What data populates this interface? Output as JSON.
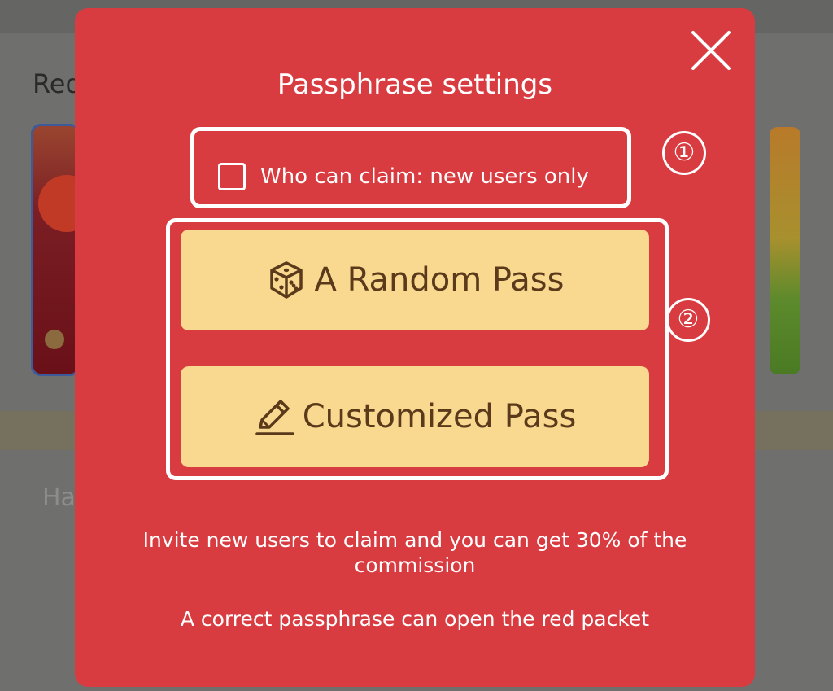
{
  "background": {
    "heading": "Red",
    "hint": "Ha"
  },
  "modal": {
    "title": "Passphrase settings",
    "close_icon": "close-icon",
    "claim_option": {
      "label": "Who can claim: new users only",
      "checked": false
    },
    "annotation_markers": [
      "①",
      "②"
    ],
    "buttons": [
      {
        "label": "A Random Pass",
        "icon": "dice-icon"
      },
      {
        "label": "Customized Pass",
        "icon": "pencil-icon"
      }
    ],
    "info_commission": "Invite new users to claim and you can get 30% of the commission",
    "info_passphrase": "A correct passphrase can open the red packet"
  },
  "colors": {
    "modal_background": "#d93c40",
    "button_background": "#f9d890",
    "button_text": "#5a3a1a",
    "overlay": "#6f6f6d"
  }
}
